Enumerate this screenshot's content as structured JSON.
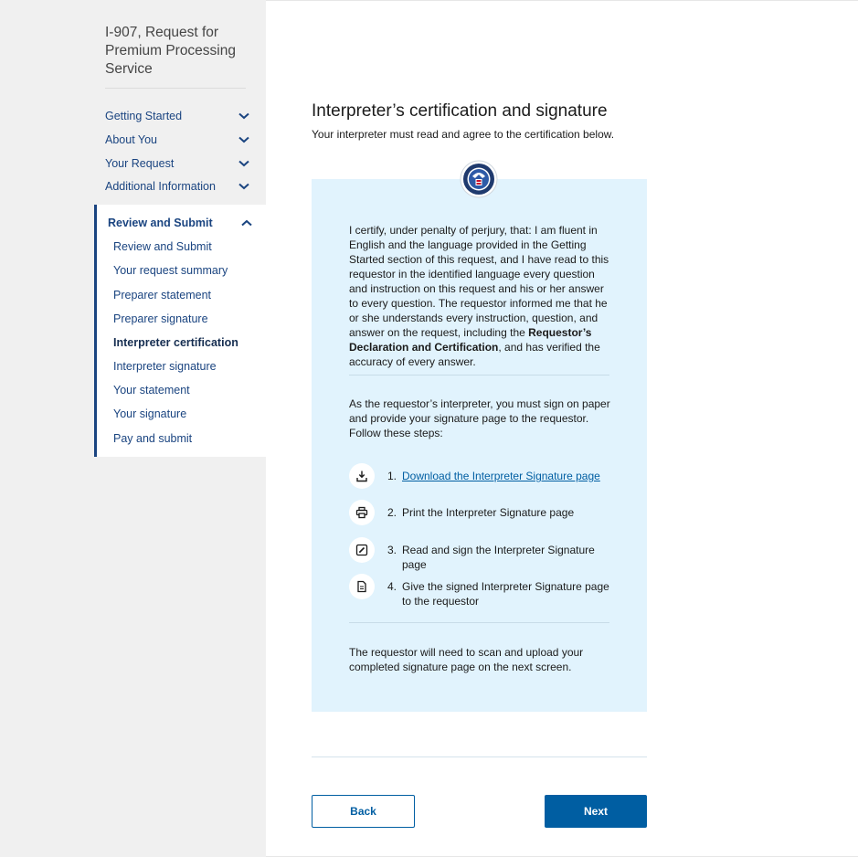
{
  "sidebar": {
    "form_title": "I-907, Request for Premium Processing Service",
    "sections": [
      {
        "label": "Getting Started",
        "icon": "chevron-down-icon"
      },
      {
        "label": "About You",
        "icon": "chevron-down-icon"
      },
      {
        "label": "Your Request",
        "icon": "chevron-down-icon"
      },
      {
        "label": "Additional Information",
        "icon": "chevron-down-icon"
      }
    ],
    "active_section": {
      "label": "Review and Submit",
      "icon": "chevron-up-icon",
      "items": [
        "Review and Submit",
        "Your request summary",
        "Preparer statement",
        "Preparer signature",
        "Interpreter certification",
        "Interpreter signature",
        "Your statement",
        "Your signature",
        "Pay and submit"
      ],
      "current_item": "Interpreter certification"
    }
  },
  "main": {
    "title": "Interpreter’s certification and signature",
    "subtitle": "Your interpreter must read and agree to the certification below.",
    "seal_icon": "dhs-seal-icon",
    "certification": {
      "text_before": "I certify, under penalty of perjury, that: I am fluent in English and the language provided in the Getting Started section of this request, and I have read to this requestor in the identified language every question and instruction on this request and his or her answer to every question. The requestor informed me that he or she understands every instruction, question, and answer on the request, including the ",
      "text_bold": "Requestor’s Declaration and Certification",
      "text_after": ", and has verified the accuracy of every answer."
    },
    "instructions": "As the requestor’s interpreter, you must sign on paper and provide your signature page to the requestor. Follow these steps:",
    "steps": [
      {
        "number": "1.",
        "text": "Download the Interpreter Signature page",
        "icon": "download-icon"
      },
      {
        "number": "2.",
        "text": "Print the Interpreter Signature page",
        "icon": "printer-icon"
      },
      {
        "number": "3.",
        "text": "Read and sign the Interpreter Signature page",
        "icon": "edit-icon"
      },
      {
        "number": "4.",
        "text": "Give the signed Interpreter Signature page to the requestor",
        "icon": "document-icon"
      }
    ],
    "footer_note": "The requestor will need to scan and upload your completed signature page on the next screen."
  },
  "buttons": {
    "back": "Back",
    "next": "Next"
  },
  "colors": {
    "sidebar_bg": "#f0f0f0",
    "nav_link": "#1a4480",
    "cert_box_bg": "#e1f3fd",
    "primary": "#005ea2"
  }
}
